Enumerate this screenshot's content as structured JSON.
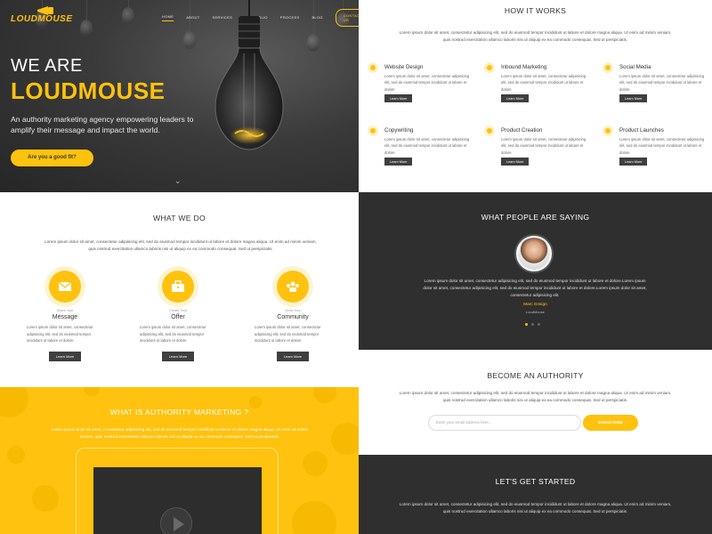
{
  "brand": {
    "logo_text": "LOUDMOUSE",
    "accent": "#ffc20e",
    "dark": "#2f2f2f"
  },
  "nav": {
    "items": [
      "HOME",
      "ABOUT",
      "SERVICES",
      "PORTFOLIO",
      "PROCESS",
      "BLOG"
    ],
    "contact": "CONTACT US"
  },
  "hero": {
    "we_are": "WE ARE",
    "brand": "LOUDMOUSE",
    "tagline": "An authority marketing agency empowering leaders to amplify their message and impact the world.",
    "cta": "Are you a good fit?",
    "scroll_icon": "chevron-down-icon"
  },
  "what_we_do": {
    "title": "WHAT WE DO",
    "intro": "Lorem ipsum dolor sit amet, consectetur adipisicing elit, sed do eiusmod tempor incididunt ut labore et dolore magna aliqua. Ut enim ad minim veniam, quis nostrud exercitation ullamco laboris nisi ut aliquip ex ea commodo consequat. Sed ut perspiciatis.",
    "features": [
      {
        "icon": "envelope-icon",
        "small": "Share Your",
        "name": "Message",
        "desc": "Lorem ipsum dolor sit amet, consectetur adipisicing elit, sed do eiusmod tempor incididunt ut labore et dolore",
        "button": "Learn More"
      },
      {
        "icon": "briefcase-icon",
        "small": "Create Your",
        "name": "Offer",
        "desc": "Lorem ipsum dolor sit amet, consectetur adipisicing elit, sed do eiusmod tempor incididunt ut labore et dolore",
        "button": "Learn More"
      },
      {
        "icon": "community-icon",
        "small": "Grow Your",
        "name": "Community",
        "desc": "Lorem ipsum dolor sit amet, consectetur adipisicing elit, sed do eiusmod tempor incididunt ut labore et dolore",
        "button": "Learn More"
      }
    ]
  },
  "authority_marketing": {
    "title": "WHAT IS AUTHORITY MARKETING ?",
    "intro": "Lorem ipsum dolor sit amet, consectetur adipisicing elit, sed do eiusmod tempor incididunt ut labore et dolore magna aliqua. Ut enim ad minim veniam, quis nostrud exercitation ullamco laboris nisi ut aliquip ex ea commodo consequat. Sed ut perspiciatis."
  },
  "how_it_works": {
    "title": "HOW IT WORKS",
    "intro": "Lorem ipsum dolor sit amet, consectetur adipisicing elit, sed do eiusmod tempor incididunt ut labore et dolore magna aliqua. Ut enim ad minim veniam, quis nostrud exercitation ullamco laboris nisi ut aliquip ex ea commodo consequat. Sed ut perspiciatis.",
    "items": [
      {
        "icon": "pencil-icon",
        "title": "Website Design",
        "desc": "Lorem ipsum dolor sit amet, consectetur adipisicing elit, sed do eiusmod tempor incididunt ut labore et dolore",
        "button": "Learn More"
      },
      {
        "icon": "magnet-icon",
        "title": "Inbound Marketing",
        "desc": "Lorem ipsum dolor sit amet, consectetur adipisicing elit, sed do eiusmod tempor incididunt ut labore et dolore",
        "button": "Learn More"
      },
      {
        "icon": "share-icon",
        "title": "Social Media",
        "desc": "Lorem ipsum dolor sit amet, consectetur adipisicing elit, sed do eiusmod tempor incididunt ut labore et dolore",
        "button": "Learn More"
      },
      {
        "icon": "document-icon",
        "title": "Copywriting",
        "desc": "Lorem ipsum dolor sit amet, consectetur adipisicing elit, sed do eiusmod tempor incididunt ut labore et dolore",
        "button": "Learn More"
      },
      {
        "icon": "fire-icon",
        "title": "Product Creation",
        "desc": "Lorem ipsum dolor sit amet, consectetur adipisicing elit, sed do eiusmod tempor incididunt ut labore et dolore",
        "button": "Learn More"
      },
      {
        "icon": "rocket-icon",
        "title": "Product Launches",
        "desc": "Lorem ipsum dolor sit amet, consectetur adipisicing elit, sed do eiusmod tempor incididunt ut labore et dolore",
        "button": "Learn More"
      }
    ]
  },
  "testimonials": {
    "title": "WHAT PEOPLE ARE SAYING",
    "quote": "Lorem ipsum dolor sit amet, consectetur adipisicing elit, sed do eiusmod tempor incididunt ut labore et dolore.Lorem ipsum dolor sit amet, consectetur adipisicing elit, sed do eiusmod tempor incididunt ut labore et dolore.Lorem ipsum dolor sit amet, consectetur adipisicing elit.",
    "name": "Marc Ensign",
    "company": "LoudMouse"
  },
  "become_authority": {
    "title": "BECOME AN AUTHORITY",
    "intro": "Lorem ipsum dolor sit amet, consectetur adipisicing elit, sed do eiusmod tempor incididunt ut labore et dolore magna aliqua. Ut enim ad minim veniam, quis nostrud exercitation ullamco laboris nisi ut aliquip ex ea commodo consequat. Sed ut perspiciatis.",
    "email_placeholder": "Enter your email address here...",
    "subscribe": "SUBSCRIBE"
  },
  "get_started": {
    "title": "LET'S GET STARTED",
    "intro": "Lorem ipsum dolor sit amet, consectetur adipisicing elit, sed do eiusmod tempor incididunt ut labore et dolore magna aliqua. Ut enim ad minim veniam, quis nostrud exercitation ullamco laboris nisi ut aliquip ex ea commodo consequat. Sed ut perspiciatis."
  }
}
